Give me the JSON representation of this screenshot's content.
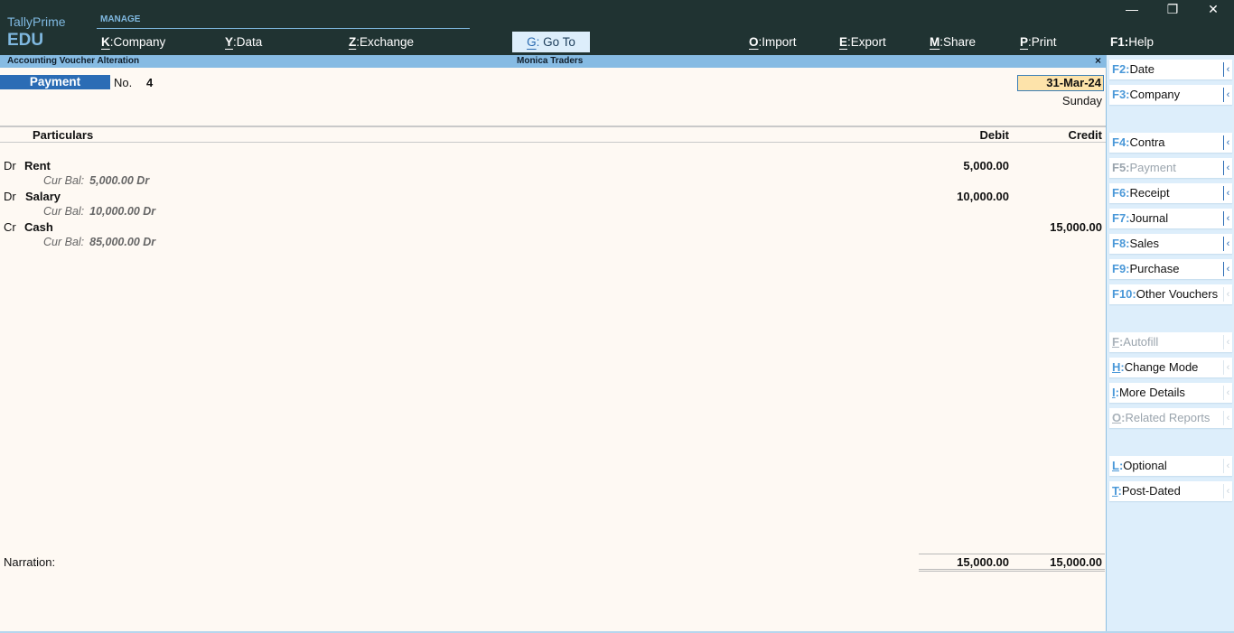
{
  "app": {
    "name": "TallyPrime",
    "edition": "EDU"
  },
  "topmenu": {
    "section_label": "MANAGE",
    "items": [
      {
        "key": "K",
        "label": "Company"
      },
      {
        "key": "Y",
        "label": "Data"
      },
      {
        "key": "Z",
        "label": "Exchange"
      },
      {
        "key": "G",
        "label": "Go To"
      },
      {
        "key": "O",
        "label": "Import"
      },
      {
        "key": "E",
        "label": "Export"
      },
      {
        "key": "M",
        "label": "Share"
      },
      {
        "key": "P",
        "label": "Print"
      },
      {
        "key": "F1",
        "label": "Help"
      }
    ]
  },
  "window_controls": {
    "minimize": "—",
    "restore": "❐",
    "close": "✕"
  },
  "titlebar": {
    "screen": "Accounting Voucher Alteration",
    "company": "Monica Traders",
    "close": "×"
  },
  "voucher": {
    "type": "Payment",
    "no_label": "No.",
    "number": "4",
    "date": "31-Mar-24",
    "day": "Sunday",
    "columns": {
      "particulars": "Particulars",
      "debit": "Debit",
      "credit": "Credit"
    },
    "entries": [
      {
        "drcr": "Dr",
        "ledger": "Rent",
        "debit": "5,000.00",
        "credit": "",
        "bal_label": "Cur Bal:",
        "balance": "5,000.00 Dr"
      },
      {
        "drcr": "Dr",
        "ledger": "Salary",
        "debit": "10,000.00",
        "credit": "",
        "bal_label": "Cur Bal:",
        "balance": "10,000.00 Dr"
      },
      {
        "drcr": "Cr",
        "ledger": "Cash",
        "debit": "",
        "credit": "15,000.00",
        "bal_label": "Cur Bal:",
        "balance": "85,000.00 Dr"
      }
    ],
    "narration_label": "Narration:",
    "total_debit": "15,000.00",
    "total_credit": "15,000.00"
  },
  "sidebar": {
    "buttons": [
      {
        "key": "F2",
        "label": "Date",
        "enabled": true
      },
      {
        "key": "F3",
        "label": "Company",
        "enabled": true
      },
      {
        "key": "F4",
        "label": "Contra",
        "enabled": true
      },
      {
        "key": "F5",
        "label": "Payment",
        "enabled": false
      },
      {
        "key": "F6",
        "label": "Receipt",
        "enabled": true
      },
      {
        "key": "F7",
        "label": "Journal",
        "enabled": true
      },
      {
        "key": "F8",
        "label": "Sales",
        "enabled": true
      },
      {
        "key": "F9",
        "label": "Purchase",
        "enabled": true
      },
      {
        "key": "F10",
        "label": "Other Vouchers",
        "enabled": true
      },
      {
        "key": "F",
        "label": "Autofill",
        "enabled": false
      },
      {
        "key": "H",
        "label": "Change Mode",
        "enabled": true
      },
      {
        "key": "I",
        "label": "More Details",
        "enabled": true
      },
      {
        "key": "O",
        "label": "Related Reports",
        "enabled": false
      },
      {
        "key": "L",
        "label": "Optional",
        "enabled": true
      },
      {
        "key": "T",
        "label": "Post-Dated",
        "enabled": true
      }
    ],
    "arrow": "‹"
  }
}
